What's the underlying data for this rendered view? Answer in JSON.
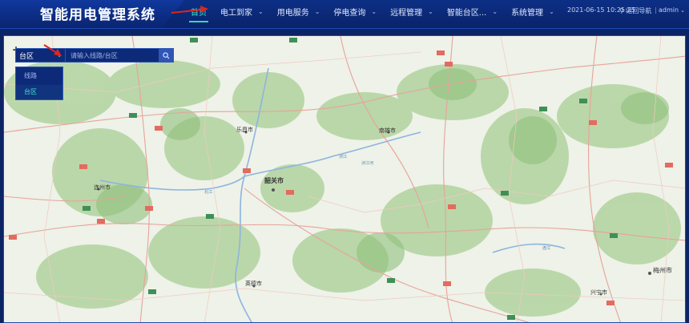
{
  "app": {
    "title": "智能用电管理系统"
  },
  "nav": {
    "items": [
      {
        "label": "首页",
        "active": true,
        "has_menu": false
      },
      {
        "label": "电工到家",
        "has_menu": true
      },
      {
        "label": "用电服务",
        "has_menu": true
      },
      {
        "label": "停电查询",
        "has_menu": true
      },
      {
        "label": "远程管理",
        "has_menu": true
      },
      {
        "label": "智能台区...",
        "has_menu": true
      },
      {
        "label": "系统管理",
        "has_menu": true
      }
    ]
  },
  "header": {
    "datetime": "2021-06-15 10:25:25",
    "back_label": "返回导航",
    "separator": "|",
    "user": "admin"
  },
  "search": {
    "selected": "台区",
    "placeholder": "请输入线路/台区",
    "options": [
      "线路",
      "台区"
    ]
  },
  "map": {
    "zoom_in": "+",
    "cities": [
      {
        "name": "乐昌市",
        "kind": "city"
      },
      {
        "name": "南雄市",
        "kind": "city"
      },
      {
        "name": "连州市",
        "kind": "city"
      },
      {
        "name": "韶关市",
        "kind": "major"
      },
      {
        "name": "英德市",
        "kind": "city"
      },
      {
        "name": "兴宁市",
        "kind": "city"
      },
      {
        "name": "梅州市",
        "kind": "major"
      }
    ],
    "rivers": [
      "北江",
      "浈江",
      "浈江河",
      "连江"
    ]
  },
  "colors": {
    "accent": "#36d6c4",
    "header_bg": "#0c2f86",
    "panel": "#0d2a78"
  }
}
